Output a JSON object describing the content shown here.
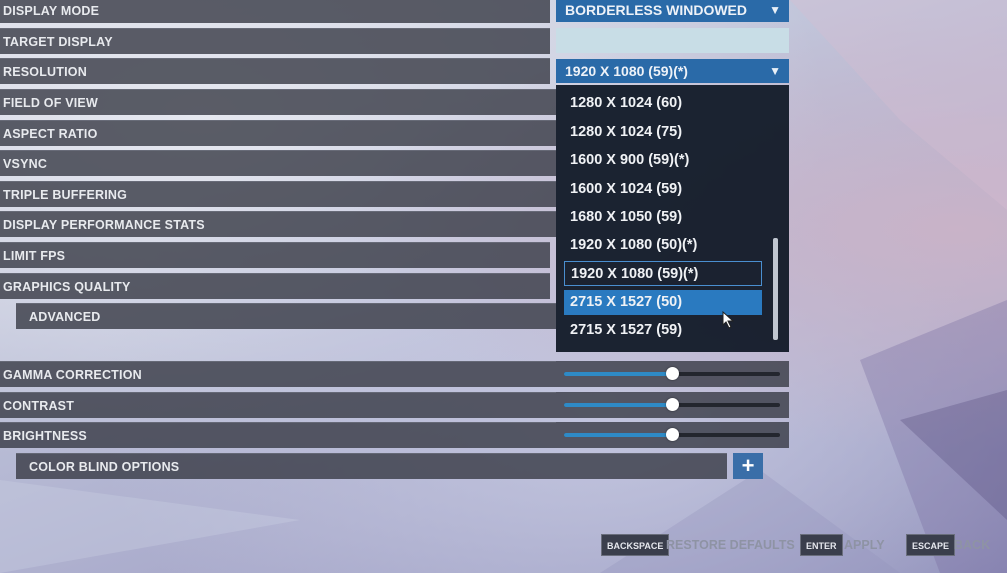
{
  "settings": {
    "display_mode": "DISPLAY MODE",
    "target_display": "TARGET DISPLAY",
    "resolution": "RESOLUTION",
    "field_of_view": "FIELD OF VIEW",
    "aspect_ratio": "ASPECT RATIO",
    "vsync": "VSYNC",
    "triple_buffering": "TRIPLE BUFFERING",
    "display_performance_stats": "DISPLAY PERFORMANCE STATS",
    "limit_fps": "LIMIT FPS",
    "graphics_quality": "GRAPHICS QUALITY",
    "advanced": "ADVANCED",
    "gamma_correction": "GAMMA CORRECTION",
    "contrast": "CONTRAST",
    "brightness": "BRIGHTNESS",
    "color_blind_options": "COLOR BLIND OPTIONS"
  },
  "values": {
    "display_mode": "BORDERLESS WINDOWED",
    "resolution": "1920 X 1080 (59)(*)"
  },
  "resolution_options": [
    "1280 X 1024 (60)",
    "1280 X 1024 (75)",
    "1600 X 900 (59)(*)",
    "1600 X 1024 (59)",
    "1680 X 1050 (59)",
    "1920 X 1080 (50)(*)",
    "1920 X 1080 (59)(*)",
    "2715 X 1527 (50)",
    "2715 X 1527 (59)"
  ],
  "sliders": {
    "gamma_level": 0.5,
    "contrast_level": 0.5,
    "brightness_level": 0.5
  },
  "footer": {
    "backspace_key": "BACKSPACE",
    "restore_defaults": "RESTORE DEFAULTS",
    "enter_key": "ENTER",
    "apply": "APPLY",
    "escape_key": "ESCAPE",
    "back": "BACK"
  },
  "icons": {
    "chevron": "chevron-down-icon",
    "plus": "plus-icon",
    "cursor": "mouse-cursor-icon"
  },
  "colors": {
    "accent": "#2a6aa8",
    "highlight": "#2a7ac0",
    "row_bg": "#3a3d48"
  }
}
